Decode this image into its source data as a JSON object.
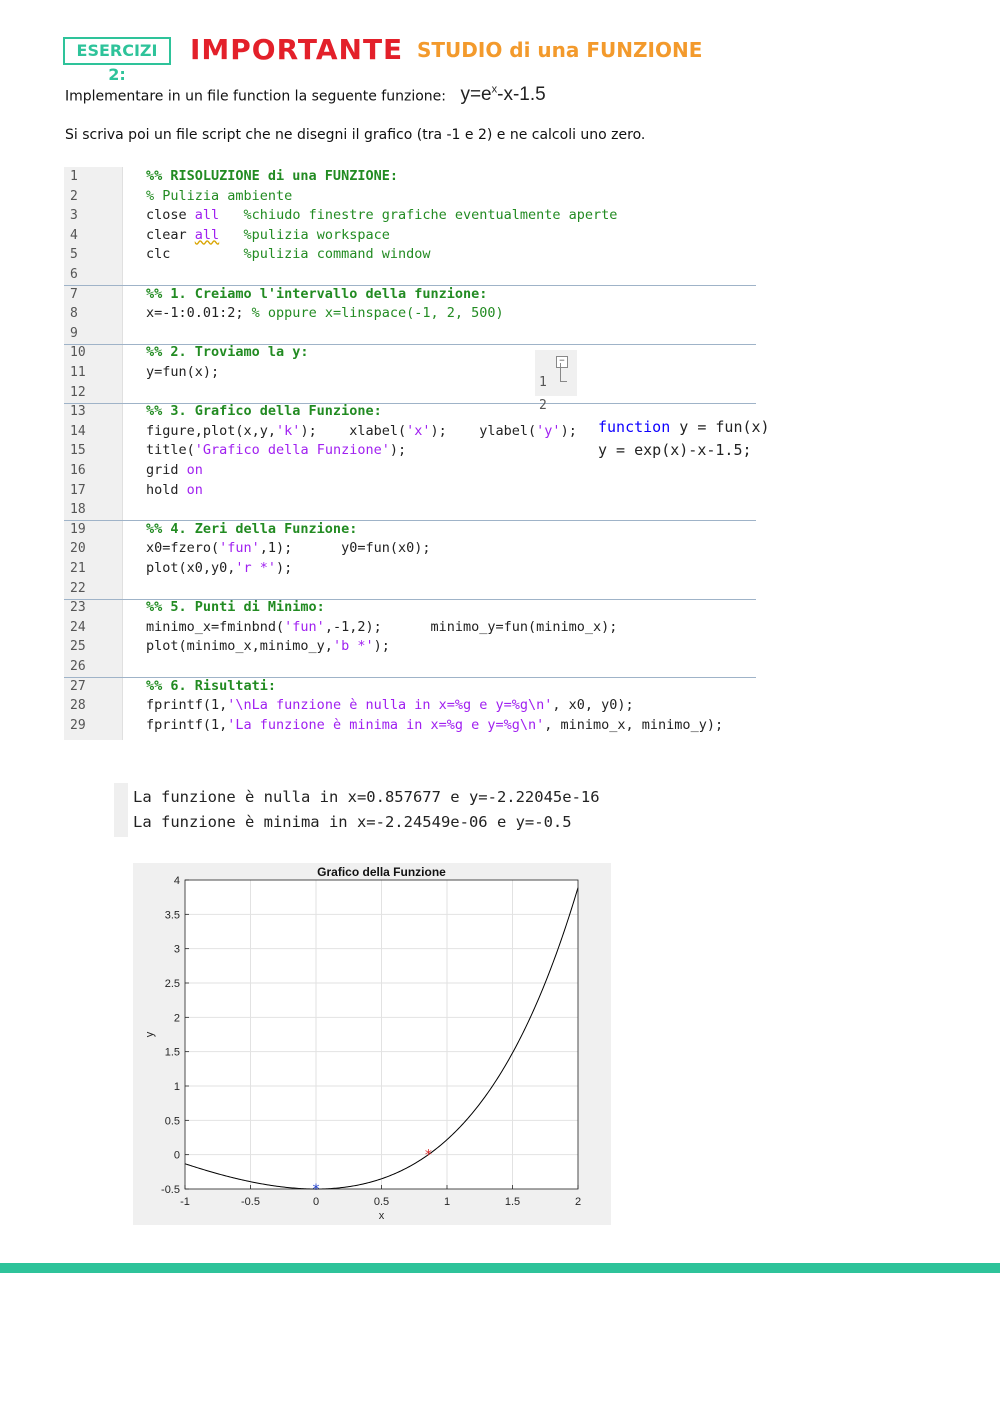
{
  "header": {
    "tag": "ESERCIZI 2:",
    "important": "IMPORTANTE",
    "subtitle": "STUDIO di una FUNZIONE"
  },
  "intro": {
    "line1": "Implementare in un file function la seguente funzione:",
    "formula_base": "y=e",
    "formula_sup": "x",
    "formula_rest": "-x-1.5",
    "line2": "Si scriva poi un file script che ne disegni il grafico (tra -1 e 2) e ne calcoli uno zero."
  },
  "script": {
    "lines": [
      "1",
      "2",
      "3",
      "4",
      "5",
      "6",
      "7",
      "8",
      "9",
      "10",
      "11",
      "12",
      "13",
      "14",
      "15",
      "16",
      "17",
      "18",
      "19",
      "20",
      "21",
      "22",
      "23",
      "24",
      "25",
      "26",
      "27",
      "28",
      "29"
    ],
    "c1": "%% RISOLUZIONE di una FUNZIONE:",
    "c2": "% Pulizia ambiente",
    "c3a": "close ",
    "c3b": "all",
    "c3c": "   %chiudo finestre grafiche eventualmente aperte",
    "c4a": "clear ",
    "c4b": "all",
    "c4c": "   %pulizia workspace",
    "c5a": "clc",
    "c5c": "         %pulizia command window",
    "c7": "%% 1. Creiamo l'intervallo della funzione:",
    "c8a": "x=-1:0.01:2; ",
    "c8c": "% oppure x=linspace(-1, 2, 500)",
    "c10": "%% 2. Troviamo la y:",
    "c11": "y=fun(x);",
    "c13": "%% 3. Grafico della Funzione:",
    "c14a": "figure,plot(x,y,",
    "c14b": "'k'",
    "c14c": ");    xlabel(",
    "c14d": "'x'",
    "c14e": ");    ylabel(",
    "c14f": "'y'",
    "c14g": ");",
    "c15a": "title(",
    "c15b": "'Grafico della Funzione'",
    "c15c": ");",
    "c16a": "grid ",
    "c16b": "on",
    "c17a": "hold ",
    "c17b": "on",
    "c19": "%% 4. Zeri della Funzione:",
    "c20a": "x0=fzero(",
    "c20b": "'fun'",
    "c20c": ",1);      y0=fun(x0);",
    "c21a": "plot(x0,y0,",
    "c21b": "'r *'",
    "c21c": ");",
    "c23": "%% 5. Punti di Minimo:",
    "c24a": "minimo_x=fminbnd(",
    "c24b": "'fun'",
    "c24c": ",-1,2);      minimo_y=fun(minimo_x);",
    "c25a": "plot(minimo_x,minimo_y,",
    "c25b": "'b *'",
    "c25c": ");",
    "c27": "%% 6. Risultati:",
    "c28a": "fprintf(1,",
    "c28b": "'\\nLa funzione è nulla in x=%g e y=%g\\n'",
    "c28c": ", x0, y0);",
    "c29a": "fprintf(1,",
    "c29b": "'La funzione è minima in x=%g e y=%g\\n'",
    "c29c": ", minimo_x, minimo_y);"
  },
  "function_file": {
    "ln1": "1",
    "ln2": "2",
    "l1a": "function",
    "l1b": " y = fun(x)",
    "l2": "y = exp(x)-x-1.5;"
  },
  "console": {
    "line1": "La funzione è nulla in x=0.857677 e y=-2.22045e-16",
    "line2": "La funzione è minima in x=-2.24549e-06 e y=-0.5"
  },
  "chart_data": {
    "type": "line",
    "title": "Grafico della Funzione",
    "xlabel": "x",
    "ylabel": "y",
    "xlim": [
      -1,
      2
    ],
    "ylim": [
      -0.5,
      4
    ],
    "xticks": [
      "-1",
      "-0.5",
      "0",
      "0.5",
      "1",
      "1.5",
      "2"
    ],
    "yticks": [
      "-0.5",
      "0",
      "0.5",
      "1",
      "1.5",
      "2",
      "2.5",
      "3",
      "3.5",
      "4"
    ],
    "grid": true,
    "function": "exp(x)-x-1.5",
    "series": [
      {
        "color": "#000000",
        "x": [
          -1,
          -0.75,
          -0.5,
          -0.25,
          0,
          0.25,
          0.5,
          0.75,
          1,
          1.25,
          1.5,
          1.75,
          2
        ],
        "y": [
          -0.132,
          -0.278,
          -0.393,
          -0.471,
          -0.5,
          -0.466,
          -0.351,
          -0.133,
          0.218,
          0.74,
          1.482,
          2.505,
          3.889
        ]
      }
    ],
    "markers": [
      {
        "label": "zero",
        "x": 0.857677,
        "y": 0,
        "color": "#d62a2a",
        "symbol": "*"
      },
      {
        "label": "minimum",
        "x": 0,
        "y": -0.5,
        "color": "#1f3fd0",
        "symbol": "*"
      }
    ]
  },
  "colors": {
    "accent_green": "#2ec39a",
    "important_red": "#e3202a",
    "subtitle_orange": "#f39a2c"
  }
}
